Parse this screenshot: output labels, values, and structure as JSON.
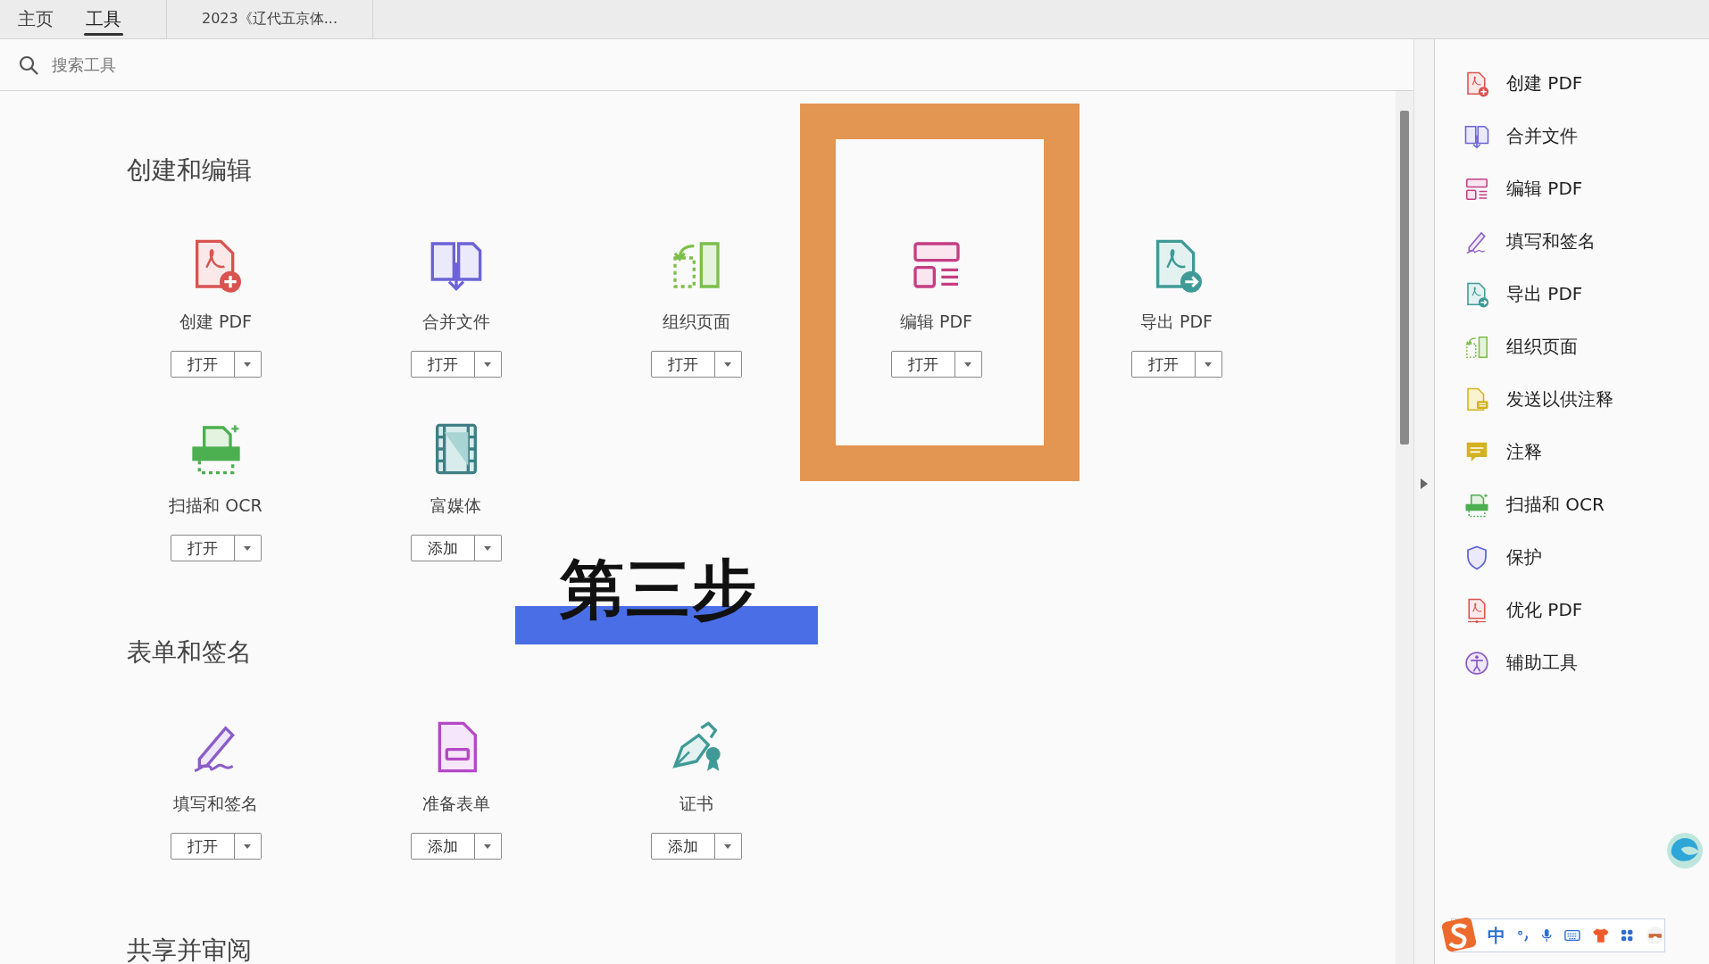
{
  "tabs": [
    {
      "label": "主页",
      "selected": false
    },
    {
      "label": "工具",
      "selected": true
    }
  ],
  "document_tab": {
    "title": "2023《辽代五京体..."
  },
  "search": {
    "placeholder": "搜索工具"
  },
  "sections": [
    {
      "title": "创建和编辑",
      "tools": [
        {
          "kind": "create",
          "label": "创建 PDF",
          "button": "打开"
        },
        {
          "kind": "combine",
          "label": "合并文件",
          "button": "打开"
        },
        {
          "kind": "organize",
          "label": "组织页面",
          "button": "打开"
        },
        {
          "kind": "edit",
          "label": "编辑 PDF",
          "button": "打开"
        },
        {
          "kind": "export",
          "label": "导出 PDF",
          "button": "打开"
        },
        {
          "kind": "scan",
          "label": "扫描和 OCR",
          "button": "打开"
        },
        {
          "kind": "media",
          "label": "富媒体",
          "button": "添加"
        }
      ]
    },
    {
      "title": "表单和签名",
      "tools": [
        {
          "kind": "fill_sign",
          "label": "填写和签名",
          "button": "打开"
        },
        {
          "kind": "prepare_form",
          "label": "准备表单",
          "button": "添加"
        },
        {
          "kind": "certificate",
          "label": "证书",
          "button": "添加"
        }
      ]
    },
    {
      "title": "共享并审阅"
    }
  ],
  "annotation": {
    "step_text": "第三步"
  },
  "side_panel": {
    "items": [
      {
        "kind": "create",
        "label": "创建 PDF"
      },
      {
        "kind": "combine",
        "label": "合并文件"
      },
      {
        "kind": "edit",
        "label": "编辑 PDF"
      },
      {
        "kind": "fill_sign",
        "label": "填写和签名"
      },
      {
        "kind": "export",
        "label": "导出 PDF"
      },
      {
        "kind": "organize",
        "label": "组织页面"
      },
      {
        "kind": "send_comment",
        "label": "发送以供注释"
      },
      {
        "kind": "comment",
        "label": "注释"
      },
      {
        "kind": "scan",
        "label": "扫描和 OCR"
      },
      {
        "kind": "protect",
        "label": "保护"
      },
      {
        "kind": "optimize",
        "label": "优化 PDF"
      },
      {
        "kind": "accessibility",
        "label": "辅助工具"
      }
    ]
  },
  "ime_toolbar": {
    "mode": "中"
  }
}
